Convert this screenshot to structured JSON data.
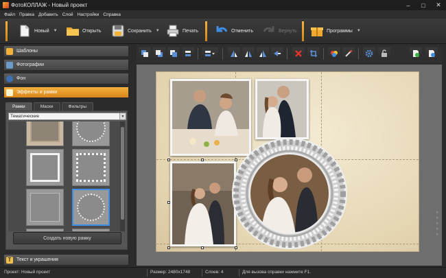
{
  "window": {
    "title": "ФотоКОЛЛАЖ - Новый проект",
    "minimize": "–",
    "maximize": "□",
    "close": "✕"
  },
  "menu": [
    "Файл",
    "Правка",
    "Добавить",
    "Слой",
    "Настройки",
    "Справка"
  ],
  "toolbar": {
    "new_label": "Новый",
    "open_label": "Открыть",
    "save_label": "Сохранить",
    "print_label": "Печать",
    "undo_label": "Отменить",
    "redo_label": "Вернуть",
    "programs_label": "Программы",
    "dropdown_arrow": "▼"
  },
  "left_panel": {
    "sections": {
      "templates": "Шаблоны",
      "photos": "Фотографии",
      "background": "Фон",
      "effects": "Эффекты и рамки",
      "text": "Текст и украшения"
    },
    "tabs": [
      "Рамки",
      "Маски",
      "Фильтры"
    ],
    "active_tab": 0,
    "category": "Тематические",
    "create_frame_label": "Создать новую рамку"
  },
  "canvas_toolbar": {
    "icons": [
      "bring-front-icon",
      "send-back-icon",
      "layer-up-icon",
      "layer-down-icon",
      "align-icon",
      "flip-left-icon",
      "flip-center-icon",
      "flip-right-icon",
      "rotate-icon",
      "delete-icon",
      "crop-icon",
      "effects-icon",
      "magic-wand-icon",
      "settings-icon",
      "lock-icon",
      "export-icon",
      "import-icon"
    ]
  },
  "side_arrows": [
    "‹",
    "‹",
    "‹",
    "‹",
    "‹"
  ],
  "status": {
    "project": "Проект:  Новый проект",
    "size": "Размер:  2480x1748",
    "layers": "Слоев:  4",
    "help": "Для вызова справки нажмите F1."
  },
  "colors": {
    "accent": "#f0a531",
    "background": "#2b2b2b",
    "selection": "#3c8ee8"
  }
}
